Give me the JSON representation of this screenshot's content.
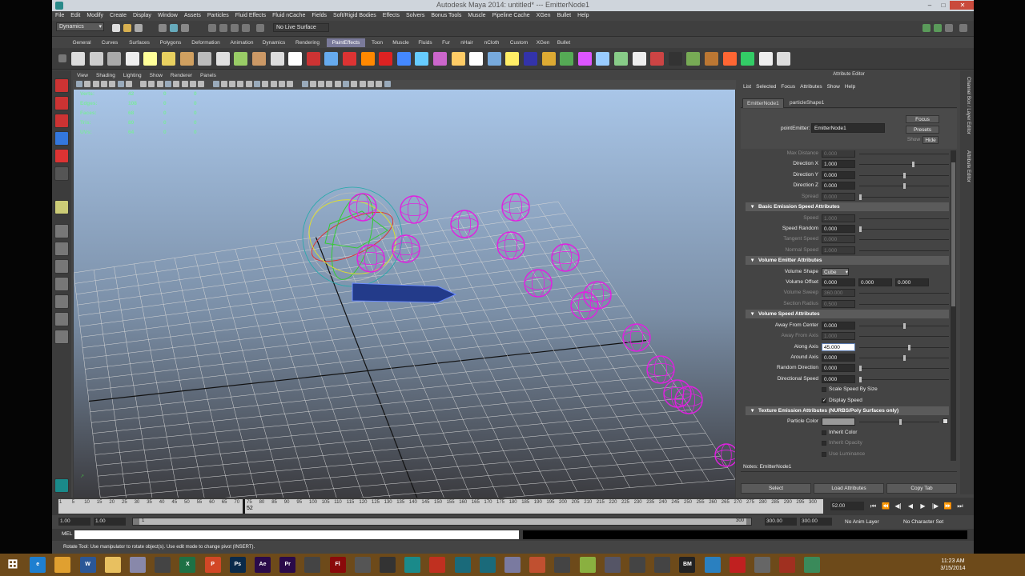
{
  "window": {
    "title": "Autodesk Maya 2014: untitled*   ---   EmitterNode1",
    "min": "–",
    "max": "□",
    "close": "✕"
  },
  "menubar": [
    "File",
    "Edit",
    "Modify",
    "Create",
    "Display",
    "Window",
    "Assets",
    "Particles",
    "Fluid Effects",
    "Fluid nCache",
    "Fields",
    "Soft/Rigid Bodies",
    "Effects",
    "Solvers",
    "Bonus Tools",
    "Muscle",
    "Pipeline Cache",
    "XGen",
    "Bullet",
    "Help"
  ],
  "status": {
    "menuset": "Dynamics",
    "live_surface": "No Live Surface"
  },
  "shelf_tabs": [
    "General",
    "Curves",
    "Surfaces",
    "Polygons",
    "Deformation",
    "Animation",
    "Dynamics",
    "Rendering",
    "PaintEffects",
    "Toon",
    "Muscle",
    "Fluids",
    "Fur",
    "nHair",
    "nCloth",
    "Custom",
    "XGen",
    "Bullet"
  ],
  "shelf_active_tab": "PaintEffects",
  "viewport": {
    "menu": [
      "View",
      "Shading",
      "Lighting",
      "Show",
      "Renderer",
      "Panels"
    ],
    "hud": [
      {
        "label": "Verts:",
        "values": [
          "42",
          "0",
          "0"
        ]
      },
      {
        "label": "Edges:",
        "values": [
          "108",
          "0",
          "0"
        ]
      },
      {
        "label": "Faces:",
        "values": [
          "68",
          "0",
          "0"
        ]
      },
      {
        "label": "Tris:",
        "values": [
          "80",
          "0",
          "0"
        ]
      },
      {
        "label": "UVs:",
        "values": [
          "64",
          "0",
          "0"
        ]
      }
    ]
  },
  "attribute_editor": {
    "title": "Attribute Editor",
    "menu": [
      "List",
      "Selected",
      "Focus",
      "Attributes",
      "Show",
      "Help"
    ],
    "tabs": [
      "EmitterNode1",
      "particleShape1"
    ],
    "active_tab": "EmitterNode1",
    "node_type_label": "pointEmitter:",
    "node_name": "EmitterNode1",
    "focus_button": "Focus",
    "presets_button": "Presets",
    "show_label": "Show",
    "hide_label": "Hide",
    "rows": [
      {
        "kind": "row",
        "label": "Max Distance",
        "value": "0.000",
        "dim": true
      },
      {
        "kind": "row",
        "label": "Direction X",
        "value": "1.000",
        "knob": 0.6
      },
      {
        "kind": "row",
        "label": "Direction Y",
        "value": "0.000",
        "knob": 0.5
      },
      {
        "kind": "row",
        "label": "Direction Z",
        "value": "0.000",
        "knob": 0.5
      },
      {
        "kind": "row",
        "label": "Spread",
        "value": "0.000",
        "dim": true,
        "knob": 0.0
      },
      {
        "kind": "section",
        "label": "Basic Emission Speed Attributes"
      },
      {
        "kind": "row",
        "label": "Speed",
        "value": "1.000",
        "dim": true
      },
      {
        "kind": "row",
        "label": "Speed Random",
        "value": "0.000",
        "knob": 0.0
      },
      {
        "kind": "row",
        "label": "Tangent Speed",
        "value": "0.000",
        "dim": true
      },
      {
        "kind": "row",
        "label": "Normal Speed",
        "value": "1.000",
        "dim": true
      },
      {
        "kind": "section",
        "label": "Volume Emitter Attributes"
      },
      {
        "kind": "dropdown",
        "label": "Volume Shape",
        "value": "Cube"
      },
      {
        "kind": "triple",
        "label": "Volume Offset",
        "values": [
          "0.000",
          "0.000",
          "0.000"
        ]
      },
      {
        "kind": "row",
        "label": "Volume Sweep",
        "value": "360.000",
        "dim": true
      },
      {
        "kind": "row",
        "label": "Section Radius",
        "value": "0.500",
        "dim": true
      },
      {
        "kind": "section",
        "label": "Volume Speed Attributes"
      },
      {
        "kind": "row",
        "label": "Away From Center",
        "value": "0.000",
        "knob": 0.5
      },
      {
        "kind": "row",
        "label": "Away From Axis",
        "value": "1.000",
        "dim": true
      },
      {
        "kind": "row",
        "label": "Along Axis",
        "value": "45.000",
        "selected": true,
        "knob": 0.55
      },
      {
        "kind": "row",
        "label": "Around Axis",
        "value": "0.000",
        "knob": 0.5
      },
      {
        "kind": "row",
        "label": "Random Direction",
        "value": "0.000",
        "knob": 0.0
      },
      {
        "kind": "row",
        "label": "Directional Speed",
        "value": "0.000",
        "knob": 0.0
      },
      {
        "kind": "check",
        "label": "Scale Speed By Size",
        "checked": false
      },
      {
        "kind": "check",
        "label": "Display Speed",
        "checked": true
      },
      {
        "kind": "section",
        "label": "Texture Emission Attributes (NURBS/Poly Surfaces only)"
      },
      {
        "kind": "color",
        "label": "Particle Color"
      },
      {
        "kind": "check",
        "label": "Inherit Color",
        "checked": false
      },
      {
        "kind": "check",
        "label": "Inherit Opacity",
        "checked": false,
        "dim": true
      },
      {
        "kind": "check",
        "label": "Use Luminance",
        "checked": false,
        "dim": true
      },
      {
        "kind": "check",
        "label": "Invert Opacity",
        "checked": false,
        "dim": true
      }
    ],
    "notes_label": "Notes: EmitterNode1",
    "buttons": [
      "Select",
      "Load Attributes",
      "Copy Tab"
    ]
  },
  "side_tabs": [
    "Channel Box / Layer Editor",
    "Attribute Editor"
  ],
  "timeline": {
    "ticks": [
      "1",
      "5",
      "10",
      "15",
      "20",
      "25",
      "30",
      "35",
      "40",
      "45",
      "50",
      "55",
      "60",
      "65",
      "70",
      "75",
      "80",
      "85",
      "90",
      "95",
      "100",
      "105",
      "110",
      "115",
      "120",
      "125",
      "130",
      "135",
      "140",
      "145",
      "150",
      "155",
      "160",
      "165",
      "170",
      "175",
      "180",
      "185",
      "190",
      "195",
      "200",
      "205",
      "210",
      "215",
      "220",
      "225",
      "230",
      "235",
      "240",
      "245",
      "250",
      "255",
      "260",
      "265",
      "270",
      "275",
      "280",
      "285",
      "290",
      "295",
      "300"
    ],
    "current_frame": "52",
    "current_field": "52.00",
    "controls": [
      "⏮",
      "⏪",
      "◀|",
      "◀",
      "▶",
      "|▶",
      "⏩",
      "⏭"
    ]
  },
  "range": {
    "start": "1.00",
    "anim_start": "1.00",
    "range_start_label": "1",
    "range_end_label": "300",
    "anim_end": "300.00",
    "end": "300.00",
    "anim_layer": "No Anim Layer",
    "char_set": "No Character Set"
  },
  "command_line": {
    "label": "MEL"
  },
  "help_line": "Rotate Tool: Use manipulator to rotate object(s). Use edit mode to change pivot (INSERT).",
  "taskbar": {
    "time": "11:23 AM",
    "date": "3/15/2014",
    "apps": [
      {
        "name": "windows-start-icon",
        "label": "",
        "color": "#6d4a1a"
      },
      {
        "name": "internet-explorer-icon",
        "label": "e",
        "color": "#1e7fd0"
      },
      {
        "name": "chrome-icon",
        "label": "",
        "color": "#e0a030"
      },
      {
        "name": "word-icon",
        "label": "W",
        "color": "#2b5797"
      },
      {
        "name": "file-explorer-icon",
        "label": "",
        "color": "#e8c060"
      },
      {
        "name": "app-icon",
        "label": "",
        "color": "#8888aa"
      },
      {
        "name": "app-icon",
        "label": "",
        "color": "#444"
      },
      {
        "name": "excel-icon",
        "label": "X",
        "color": "#1e7145"
      },
      {
        "name": "powerpoint-icon",
        "label": "P",
        "color": "#d24726"
      },
      {
        "name": "photoshop-icon",
        "label": "Ps",
        "color": "#0a2a4a"
      },
      {
        "name": "after-effects-icon",
        "label": "Ae",
        "color": "#2a0a4a"
      },
      {
        "name": "premiere-icon",
        "label": "Pr",
        "color": "#2a0a4a"
      },
      {
        "name": "app-icon",
        "label": "",
        "color": "#444"
      },
      {
        "name": "flash-icon",
        "label": "Fl",
        "color": "#8a0a0a"
      },
      {
        "name": "app-icon",
        "label": "",
        "color": "#555"
      },
      {
        "name": "unity-icon",
        "label": "",
        "color": "#333"
      },
      {
        "name": "maya-icon",
        "label": "",
        "color": "#1a8a8a"
      },
      {
        "name": "app-icon",
        "label": "",
        "color": "#c03020"
      },
      {
        "name": "maya-icon",
        "label": "",
        "color": "#1a6a7a"
      },
      {
        "name": "maya-icon",
        "label": "",
        "color": "#1a6a7a"
      },
      {
        "name": "app-icon",
        "label": "",
        "color": "#7a7aa0"
      },
      {
        "name": "app-icon",
        "label": "",
        "color": "#c05030"
      },
      {
        "name": "app-icon",
        "label": "",
        "color": "#444"
      },
      {
        "name": "app-icon",
        "label": "",
        "color": "#8ab040"
      },
      {
        "name": "app-icon",
        "label": "",
        "color": "#556"
      },
      {
        "name": "app-icon",
        "label": "",
        "color": "#444"
      },
      {
        "name": "app-icon",
        "label": "",
        "color": "#444"
      },
      {
        "name": "bmfont-icon",
        "label": "BM",
        "color": "#222"
      },
      {
        "name": "app-icon",
        "label": "",
        "color": "#2a80c0"
      },
      {
        "name": "app-icon",
        "label": "",
        "color": "#c02020"
      },
      {
        "name": "app-icon",
        "label": "",
        "color": "#666"
      },
      {
        "name": "app-icon",
        "label": "",
        "color": "#a03020"
      },
      {
        "name": "app-icon",
        "label": "",
        "color": "#3a8a5a"
      }
    ]
  },
  "colors": {
    "particle": "#e020e0",
    "viewport_top": "#a7c4e6",
    "viewport_bottom": "#3a3a3a",
    "shelf_active": "#7a7a9a"
  }
}
